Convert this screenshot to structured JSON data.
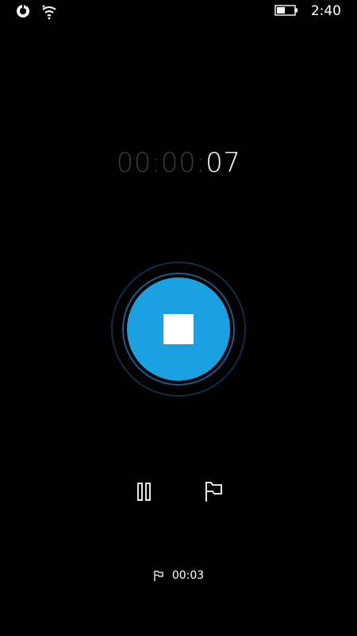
{
  "status_bar": {
    "time": "2:40",
    "icons": [
      "sync-icon",
      "wifi-icon",
      "battery-icon"
    ]
  },
  "timer": {
    "dim_part": "00:00:",
    "bright_part": "07"
  },
  "controls": {
    "record_button": "stop-square-icon",
    "pause": "pause-icon",
    "flag": "flag-icon"
  },
  "marks": [
    {
      "time": "00:03",
      "icon": "flag-icon"
    }
  ],
  "colors": {
    "background": "#000000",
    "accent": "#1ba1e2",
    "dim_text": "#3a3a3a",
    "ring_outer": "#0f2d44",
    "ring_mid": "#1b5a86"
  }
}
